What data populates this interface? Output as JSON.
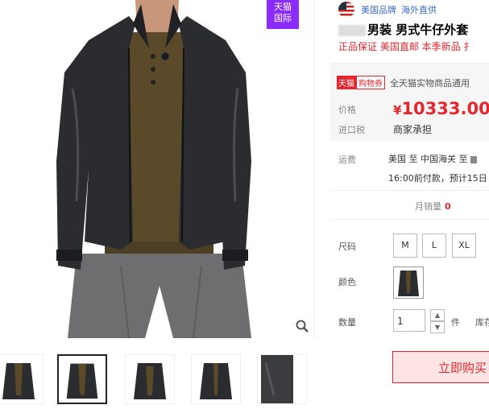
{
  "gallery": {
    "corner_badge_line1": "天猫",
    "corner_badge_line2": "国际",
    "zoom_icon": "magnifier-icon",
    "thumbnails": [
      {
        "name": "thumb-1"
      },
      {
        "name": "thumb-2",
        "active": true
      },
      {
        "name": "thumb-3"
      },
      {
        "name": "thumb-4"
      },
      {
        "name": "thumb-5"
      }
    ]
  },
  "product": {
    "brand_origin": "美国品牌",
    "brand_shipping": "海外直供",
    "title": "男装 男式牛仔外套",
    "tags": "正品保证 美国直邮 本季新品 扌"
  },
  "pricebox": {
    "coupon_tag1": "天猫",
    "coupon_tag2": "购物券",
    "coupon_text": "全天猫实物商品通用",
    "price_label": "价格",
    "currency": "¥",
    "price": "10333.00",
    "tax_label": "进口税",
    "tax_value": "商家承担"
  },
  "shipping": {
    "label": "运费",
    "route": "美国  至 中国海关 至",
    "cutoff": "16:00前付款，预计15日"
  },
  "sales": {
    "label": "月销量",
    "value": "0"
  },
  "options": {
    "size_label": "尺码",
    "sizes": [
      "M",
      "L",
      "XL"
    ],
    "color_label": "颜色",
    "qty_label": "数量",
    "qty_value": "1",
    "unit": "件",
    "stock": "库存"
  },
  "buy_label": "立即购买",
  "colors": {
    "accent": "#e5262f",
    "tmall_intl": "#8b2cff",
    "brand_link": "#3a6bd1"
  }
}
